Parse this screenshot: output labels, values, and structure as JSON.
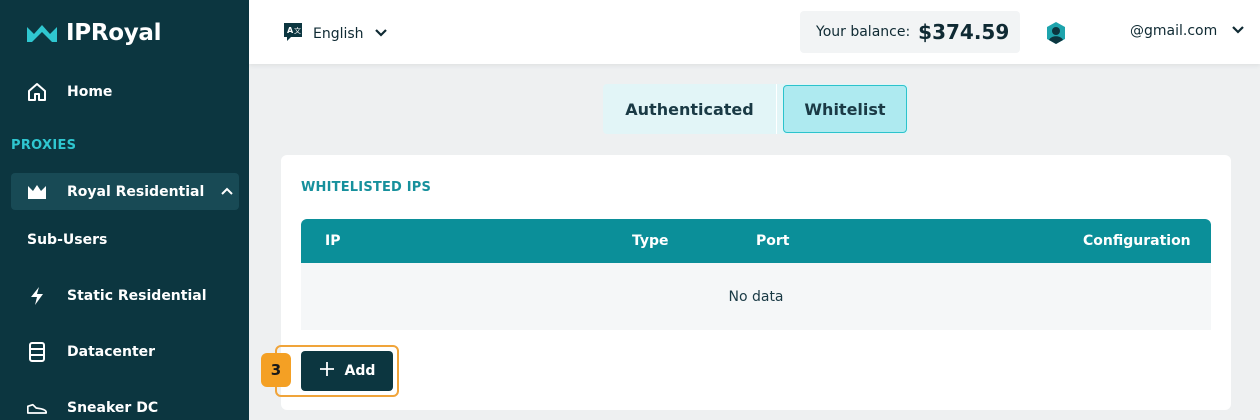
{
  "brand": {
    "name": "IPRoyal"
  },
  "sidebar": {
    "home_label": "Home",
    "section_label": "PROXIES",
    "items": [
      {
        "label": "Royal Residential",
        "icon": "crown-icon"
      },
      {
        "label": "Sub-Users"
      },
      {
        "label": "Static Residential",
        "icon": "bolt-icon"
      },
      {
        "label": "Datacenter",
        "icon": "server-icon"
      },
      {
        "label": "Sneaker DC",
        "icon": "sneaker-icon"
      }
    ]
  },
  "topbar": {
    "language": "English",
    "balance_label": "Your balance:",
    "balance_value": "$374.59",
    "account": "@gmail.com"
  },
  "tabs": [
    {
      "label": "Authenticated",
      "active": false
    },
    {
      "label": "Whitelist",
      "active": true
    }
  ],
  "card": {
    "title": "WHITELISTED IPS",
    "columns": [
      "IP",
      "Type",
      "Port",
      "Configuration"
    ],
    "empty_text": "No data",
    "add_label": "Add",
    "step_badge": "3"
  },
  "colors": {
    "sidebar_bg": "#0c3640",
    "accent": "#0b8f99",
    "tab_active": "#aeeaf0",
    "highlight": "#f0a43a"
  }
}
